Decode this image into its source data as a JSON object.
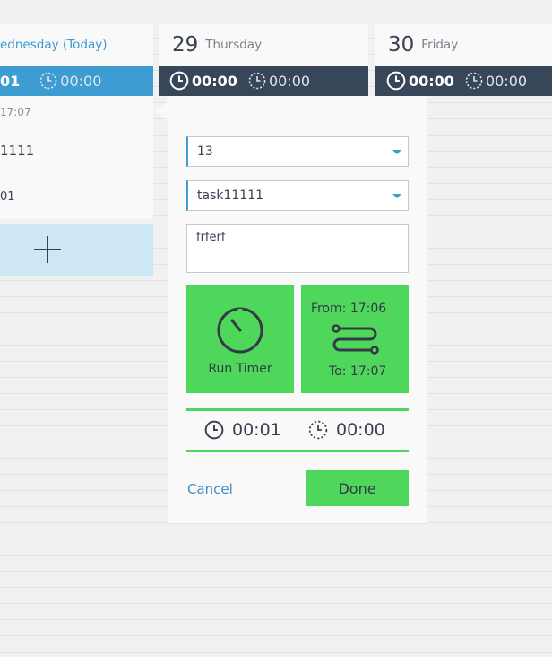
{
  "columns": [
    {
      "day_label": "ednesday (Today)",
      "tracked": "01",
      "planned": "00:00",
      "today": true
    },
    {
      "day_num": "29",
      "day_name": "Thursday",
      "tracked": "00:00",
      "planned": "00:00"
    },
    {
      "day_num": "30",
      "day_name": "Friday",
      "tracked": "00:00",
      "planned": "00:00"
    }
  ],
  "entry": {
    "time": "17:07",
    "task": "1111",
    "duration": "01"
  },
  "popover": {
    "project_select": "13",
    "task_select": "task11111",
    "notes": "frferf",
    "run_timer_label": "Run Timer",
    "from_label": "From:",
    "from_time": "17:06",
    "to_label": "To:",
    "to_time": "17:07",
    "tracked": "00:01",
    "planned": "00:00",
    "cancel_label": "Cancel",
    "done_label": "Done"
  },
  "colors": {
    "accent_blue": "#3d9dd3",
    "dark_bar": "#38465a",
    "green": "#4fd75c"
  },
  "icons": [
    "clock-icon",
    "dashed-clock-icon",
    "plus-icon",
    "timer-icon",
    "route-icon"
  ]
}
